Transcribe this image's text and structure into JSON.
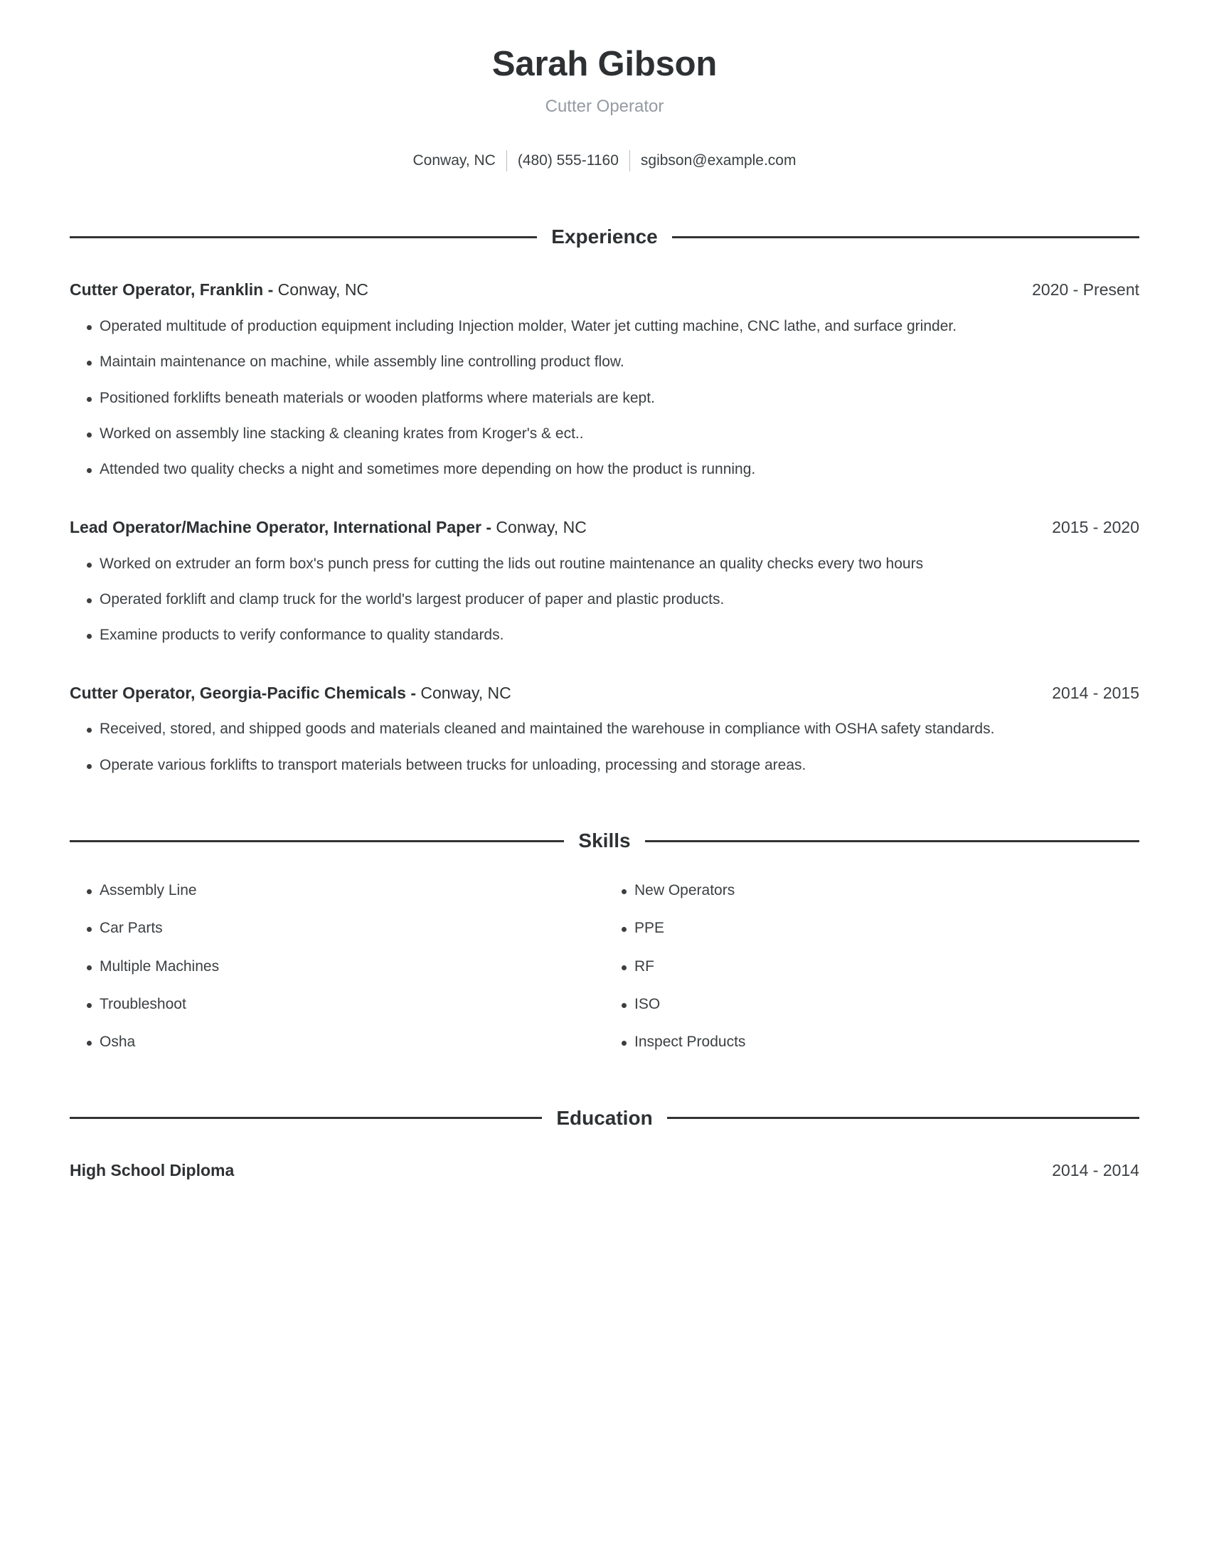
{
  "header": {
    "full_name": "Sarah Gibson",
    "job_title": "Cutter Operator",
    "location": "Conway, NC",
    "phone": "(480) 555-1160",
    "email": "sgibson@example.com"
  },
  "sections": {
    "experience_title": "Experience",
    "skills_title": "Skills",
    "education_title": "Education"
  },
  "experience": [
    {
      "title_bold": "Cutter Operator, Franklin - ",
      "title_light": "Conway, NC",
      "date": "2020 - Present",
      "bullets": [
        "Operated multitude of production equipment including Injection molder, Water jet cutting machine, CNC lathe, and surface grinder.",
        "Maintain maintenance on machine, while assembly line controlling product flow.",
        "Positioned forklifts beneath materials or wooden platforms where materials are kept.",
        "Worked on assembly line stacking & cleaning krates from Kroger's & ect..",
        "Attended two quality checks a night and sometimes more depending on how the product is running."
      ]
    },
    {
      "title_bold": "Lead Operator/Machine Operator, International Paper - ",
      "title_light": "Conway, NC",
      "date": "2015 - 2020",
      "bullets": [
        "Worked on extruder an form box's punch press for cutting the lids out routine maintenance an quality checks every two hours",
        "Operated forklift and clamp truck for the world's largest producer of paper and plastic products.",
        "Examine products to verify conformance to quality standards."
      ]
    },
    {
      "title_bold": "Cutter Operator, Georgia-Pacific Chemicals - ",
      "title_light": "Conway, NC",
      "date": "2014 - 2015",
      "bullets": [
        "Received, stored, and shipped goods and materials cleaned and maintained the warehouse in compliance with OSHA safety standards.",
        "Operate various forklifts to transport materials between trucks for unloading, processing and storage areas."
      ]
    }
  ],
  "skills": {
    "left": [
      "Assembly Line",
      "Car Parts",
      "Multiple Machines",
      "Troubleshoot",
      "Osha"
    ],
    "right": [
      "New Operators",
      "PPE",
      "RF",
      "ISO",
      "Inspect Products"
    ]
  },
  "education": [
    {
      "degree": "High School Diploma",
      "date": "2014 - 2014"
    }
  ]
}
